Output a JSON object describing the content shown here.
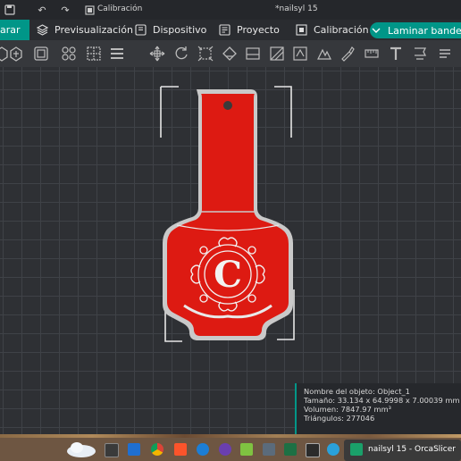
{
  "window": {
    "title": "*nailsyl 15",
    "calibration_title": "Calibración"
  },
  "menubar": {
    "prepare_label": "arar",
    "items": [
      {
        "label": "Previsualización",
        "icon": "layers-icon"
      },
      {
        "label": "Dispositivo",
        "icon": "device-icon"
      },
      {
        "label": "Proyecto",
        "icon": "project-icon"
      },
      {
        "label": "Calibración",
        "icon": "calibration-icon"
      }
    ],
    "slice_button_label": "Laminar bandeja"
  },
  "info_panel": {
    "object_name": "Nombre del objeto: Object_1",
    "size": "Tamaño: 33.134 x 64.9998 x 7.00039 mm",
    "volume": "Volumen: 7847.97 mm³",
    "triangles": "Triángulos: 277046"
  },
  "model": {
    "letter": "C",
    "body_color": "#dd1a12",
    "rim_color": "#c9c9c9",
    "accent_color": "#009688"
  },
  "taskbar": {
    "active_app_label": "nailsyl 15 - OrcaSlicer"
  }
}
